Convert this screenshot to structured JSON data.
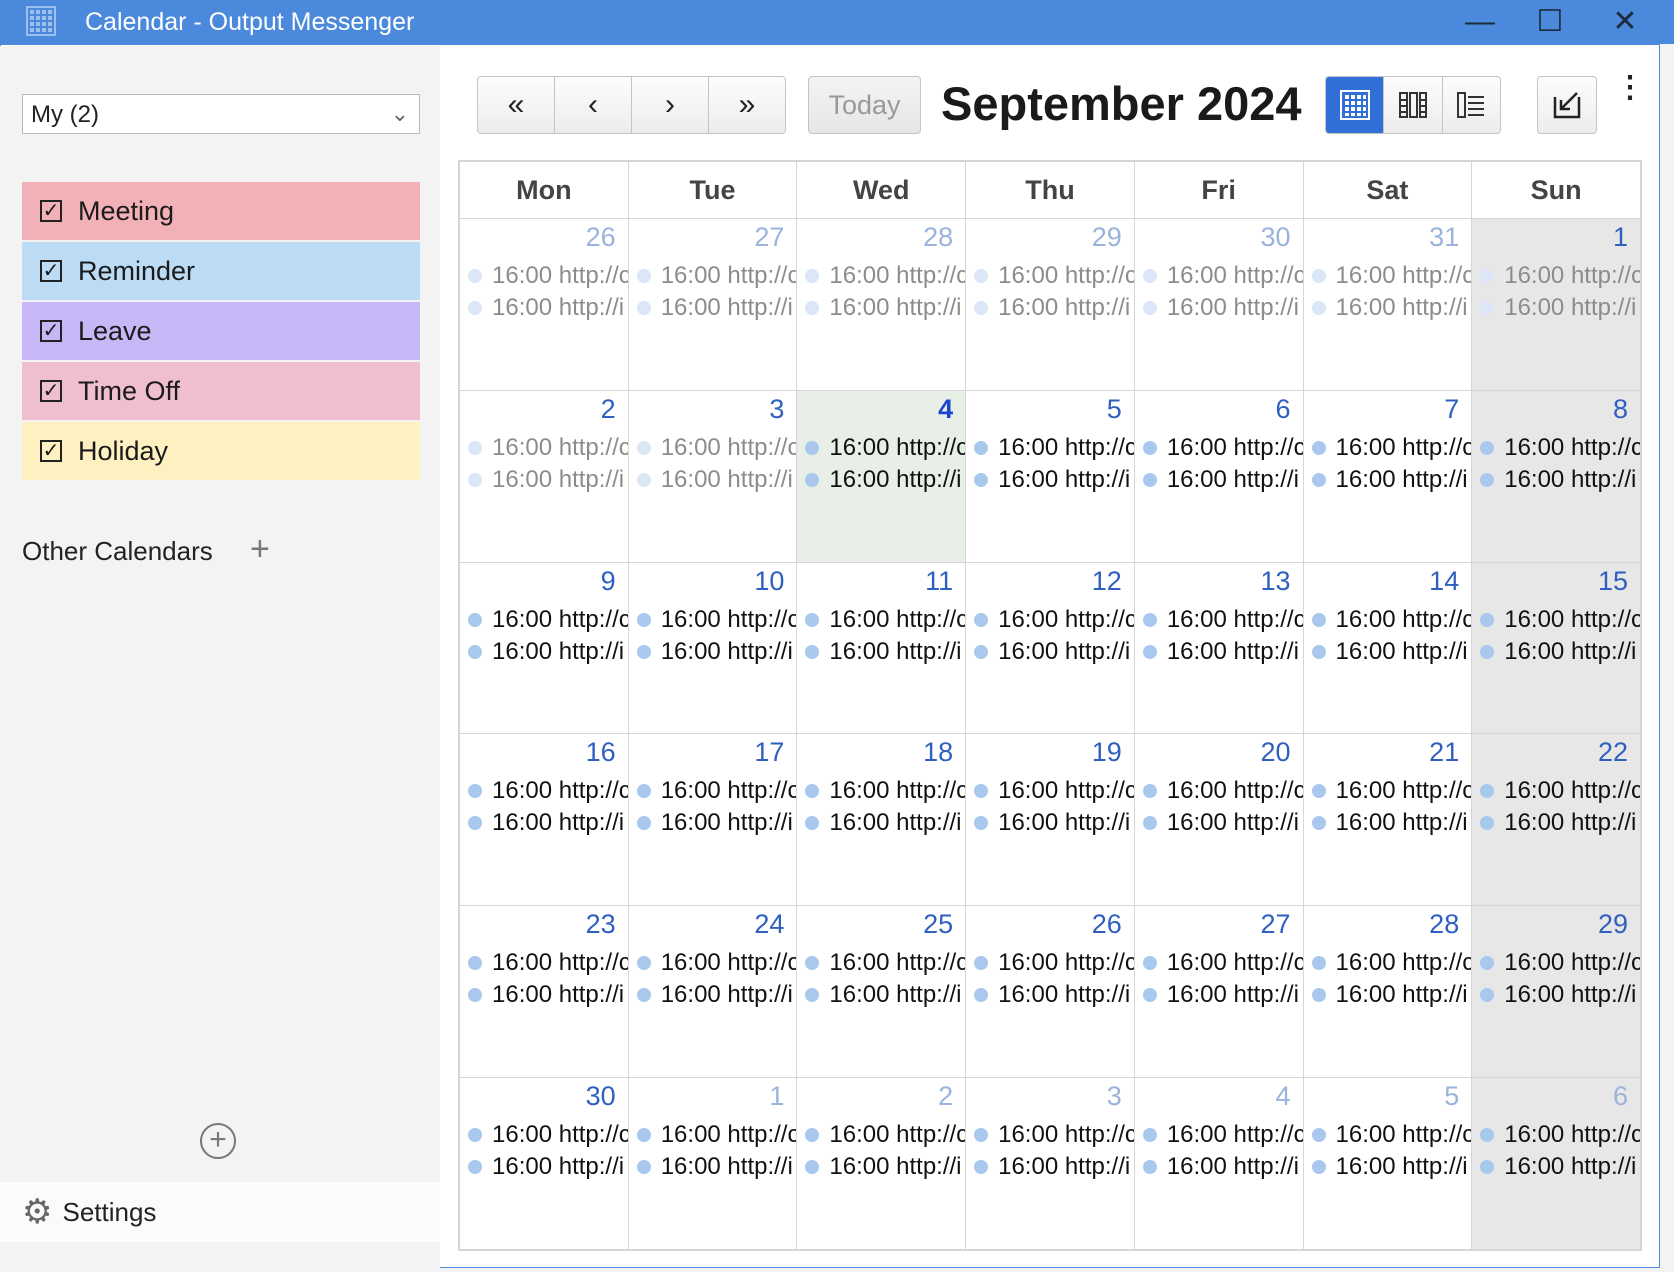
{
  "window": {
    "title": "Calendar - Output Messenger"
  },
  "sidebar": {
    "calendar_select": "My (2)",
    "categories": [
      {
        "label": "Meeting",
        "color": "#f1b1b6",
        "checked": true
      },
      {
        "label": "Reminder",
        "color": "#bcdcf6",
        "checked": true
      },
      {
        "label": "Leave",
        "color": "#c7b7f7",
        "checked": true
      },
      {
        "label": "Time Off",
        "color": "#f0bfcf",
        "checked": true
      },
      {
        "label": "Holiday",
        "color": "#fdf1c2",
        "checked": true
      }
    ],
    "other_calendars_label": "Other Calendars",
    "settings_label": "Settings"
  },
  "toolbar": {
    "today_label": "Today",
    "month_title": "September 2024",
    "nav_buttons": [
      "«",
      "‹",
      "›",
      "»"
    ],
    "active_view": "month",
    "accent_color": "#2f6fd6"
  },
  "calendar": {
    "weekdays": [
      "Mon",
      "Tue",
      "Wed",
      "Thu",
      "Fri",
      "Sat",
      "Sun"
    ],
    "event_texts": [
      "16:00 http://c",
      "16:00 http://i"
    ],
    "weeks": [
      [
        {
          "d": "26",
          "other": true,
          "dim": true
        },
        {
          "d": "27",
          "other": true,
          "dim": true
        },
        {
          "d": "28",
          "other": true,
          "dim": true
        },
        {
          "d": "29",
          "other": true,
          "dim": true
        },
        {
          "d": "30",
          "other": true,
          "dim": true
        },
        {
          "d": "31",
          "other": true,
          "dim": true
        },
        {
          "d": "1",
          "other": false,
          "dim": true
        }
      ],
      [
        {
          "d": "2",
          "other": false,
          "dim": true
        },
        {
          "d": "3",
          "other": false,
          "dim": true
        },
        {
          "d": "4",
          "other": false,
          "dim": false,
          "today": true
        },
        {
          "d": "5",
          "other": false,
          "dim": false
        },
        {
          "d": "6",
          "other": false,
          "dim": false
        },
        {
          "d": "7",
          "other": false,
          "dim": false
        },
        {
          "d": "8",
          "other": false,
          "dim": false
        }
      ],
      [
        {
          "d": "9",
          "other": false,
          "dim": false
        },
        {
          "d": "10",
          "other": false,
          "dim": false
        },
        {
          "d": "11",
          "other": false,
          "dim": false
        },
        {
          "d": "12",
          "other": false,
          "dim": false
        },
        {
          "d": "13",
          "other": false,
          "dim": false
        },
        {
          "d": "14",
          "other": false,
          "dim": false
        },
        {
          "d": "15",
          "other": false,
          "dim": false
        }
      ],
      [
        {
          "d": "16",
          "other": false,
          "dim": false
        },
        {
          "d": "17",
          "other": false,
          "dim": false
        },
        {
          "d": "18",
          "other": false,
          "dim": false
        },
        {
          "d": "19",
          "other": false,
          "dim": false
        },
        {
          "d": "20",
          "other": false,
          "dim": false
        },
        {
          "d": "21",
          "other": false,
          "dim": false
        },
        {
          "d": "22",
          "other": false,
          "dim": false
        }
      ],
      [
        {
          "d": "23",
          "other": false,
          "dim": false
        },
        {
          "d": "24",
          "other": false,
          "dim": false
        },
        {
          "d": "25",
          "other": false,
          "dim": false
        },
        {
          "d": "26",
          "other": false,
          "dim": false
        },
        {
          "d": "27",
          "other": false,
          "dim": false
        },
        {
          "d": "28",
          "other": false,
          "dim": false
        },
        {
          "d": "29",
          "other": false,
          "dim": false
        }
      ],
      [
        {
          "d": "30",
          "other": false,
          "dim": false
        },
        {
          "d": "1",
          "other": true,
          "dim": false
        },
        {
          "d": "2",
          "other": true,
          "dim": false
        },
        {
          "d": "3",
          "other": true,
          "dim": false
        },
        {
          "d": "4",
          "other": true,
          "dim": false
        },
        {
          "d": "5",
          "other": true,
          "dim": false
        },
        {
          "d": "6",
          "other": true,
          "dim": false
        }
      ]
    ]
  }
}
